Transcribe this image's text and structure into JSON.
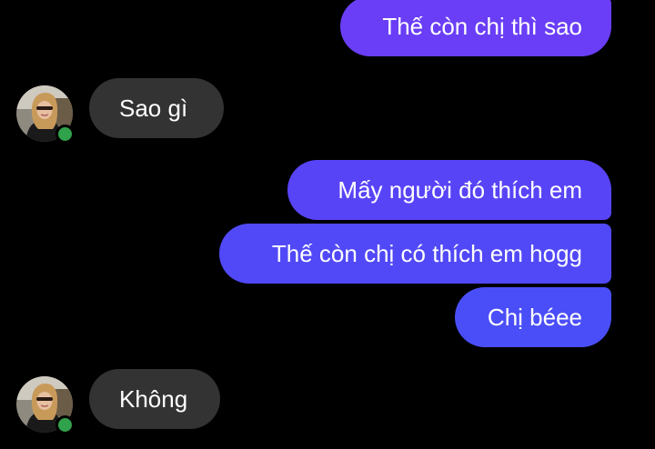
{
  "conversation": {
    "sent_color": "#6341f5",
    "received_color": "#333333",
    "online_color": "#31a24c",
    "messages": [
      {
        "from": "me",
        "text": "Thế còn chị thì sao"
      },
      {
        "from": "them",
        "text": "Sao gì",
        "avatar": "contact-avatar",
        "online": true
      },
      {
        "from": "me",
        "text": "Mấy người đó thích em"
      },
      {
        "from": "me",
        "text": "Thế còn chị có thích em hogg"
      },
      {
        "from": "me",
        "text": "Chị béee"
      },
      {
        "from": "them",
        "text": "Không",
        "avatar": "contact-avatar",
        "online": true
      }
    ]
  }
}
